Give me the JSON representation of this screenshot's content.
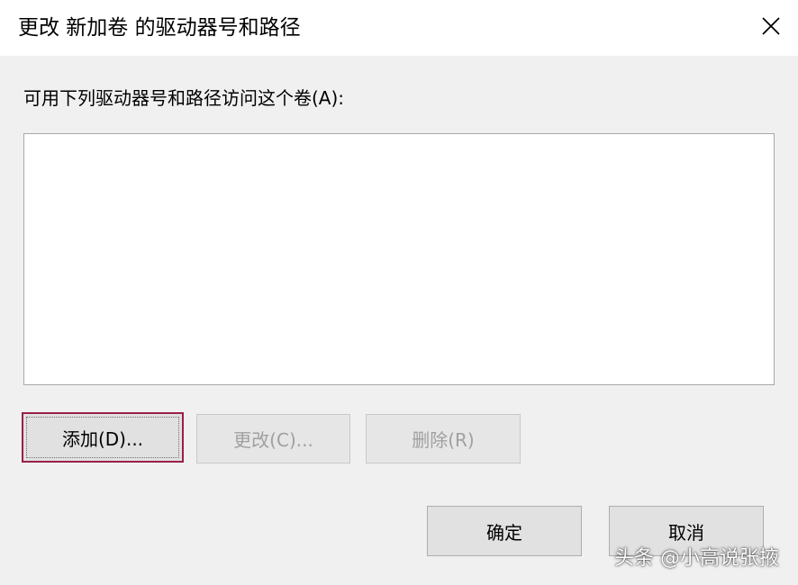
{
  "window": {
    "title": "更改 新加卷 的驱动器号和路径",
    "close_icon": "close-icon"
  },
  "main": {
    "list_label": "可用下列驱动器号和路径访问这个卷(A):",
    "list_items": []
  },
  "buttons": {
    "add_label": "添加(D)...",
    "change_label": "更改(C)...",
    "delete_label": "删除(R)",
    "ok_label": "确定",
    "cancel_label": "取消"
  },
  "watermark": {
    "text": "头条 @小高说张掖"
  },
  "colors": {
    "focus_border": "#9a1f4a",
    "dialog_bg": "#f0f0f0",
    "disabled_text": "#a0a0a0"
  }
}
